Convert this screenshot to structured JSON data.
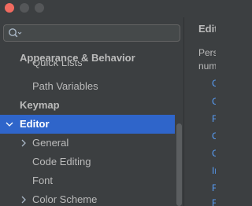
{
  "window": {
    "traffic_lights": [
      "close",
      "minimize",
      "maximize"
    ]
  },
  "search": {
    "placeholder": "",
    "icon": "search-icon"
  },
  "tree": {
    "sticky_header": "Appearance & Behavior",
    "items": [
      {
        "label": "Quick Lists"
      },
      {
        "label": "Path Variables"
      },
      {
        "label": "Keymap"
      },
      {
        "label": "Editor"
      },
      {
        "label": "General"
      },
      {
        "label": "Code Editing"
      },
      {
        "label": "Font"
      },
      {
        "label": "Color Scheme"
      }
    ]
  },
  "right_panel": {
    "title": "Edit",
    "text_line1": "Pers",
    "text_line2": "num",
    "links": [
      "C",
      "C",
      "F",
      "C",
      "C",
      "In",
      "F",
      "F"
    ]
  },
  "colors": {
    "background": "#3c3f41",
    "selection": "#2f65ca",
    "text": "#bbbbbb",
    "link": "#589df6"
  }
}
